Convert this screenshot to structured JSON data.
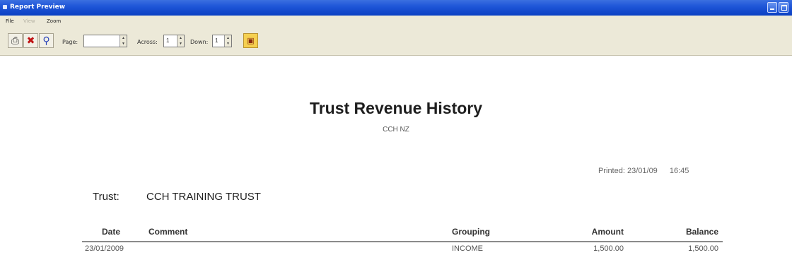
{
  "window": {
    "title": "Report Preview"
  },
  "menu": {
    "items": [
      "File",
      "View",
      "Zoom"
    ]
  },
  "toolbar": {
    "page_label": "Page:",
    "page_value": "",
    "across_label": "Across:",
    "across_value": "1",
    "down_label": "Down:",
    "down_value": "1",
    "buttons": [
      "printer-icon",
      "close-report-icon",
      "zoom-icon",
      "export-icon"
    ]
  },
  "report": {
    "title": "Trust Revenue History",
    "subtitle": "CCH NZ",
    "printed_label": "Printed:",
    "printed_date": "23/01/09",
    "printed_time": "16:45",
    "trust_label": "Trust:",
    "trust_name": "CCH TRAINING TRUST",
    "table": {
      "headers": [
        "Date",
        "Comment",
        "Grouping",
        "Amount",
        "Balance"
      ],
      "rows": [
        [
          "23/01/2009",
          "",
          "INCOME",
          "1,500.00",
          "1,500.00"
        ]
      ]
    }
  }
}
